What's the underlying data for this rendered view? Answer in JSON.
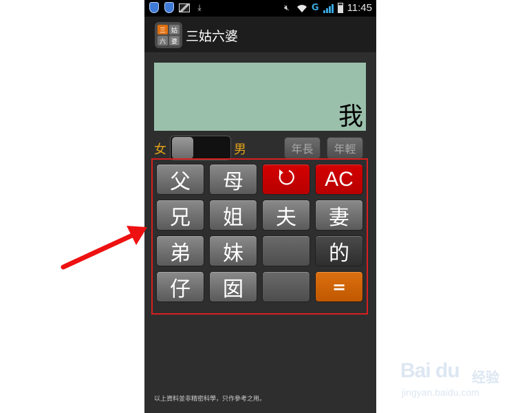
{
  "status_bar": {
    "time": "11:45",
    "network_label": "G",
    "icons": [
      "shield-icon",
      "shield-icon",
      "image-icon",
      "download-icon",
      "mute-icon",
      "wifi-icon",
      "signal-icon",
      "battery-icon"
    ]
  },
  "app": {
    "title": "三姑六婆",
    "icon_chars": [
      "三",
      "姑",
      "六",
      "婆"
    ]
  },
  "display": {
    "text": "我"
  },
  "gender": {
    "female_label": "女",
    "male_label": "男",
    "selected": "女"
  },
  "age_buttons": {
    "older_label": "年長",
    "younger_label": "年輕"
  },
  "keypad": {
    "rows": [
      [
        "父",
        "母",
        "↺",
        "AC"
      ],
      [
        "兄",
        "姐",
        "夫",
        "妻"
      ],
      [
        "弟",
        "妹",
        "",
        "的"
      ],
      [
        "仔",
        "囡",
        "",
        "="
      ]
    ]
  },
  "footer": {
    "note": "以上資料並非精密科學，只作參考之用。"
  },
  "watermark": {
    "logo": "Bai du",
    "text": "经验",
    "url": "jingyan.baidu.com"
  },
  "colors": {
    "accent_red": "#d40000",
    "accent_orange": "#dd7010",
    "gender_label": "#e2a21a",
    "display_bg": "#9ac0ac",
    "highlight_frame": "#d81f1f"
  }
}
